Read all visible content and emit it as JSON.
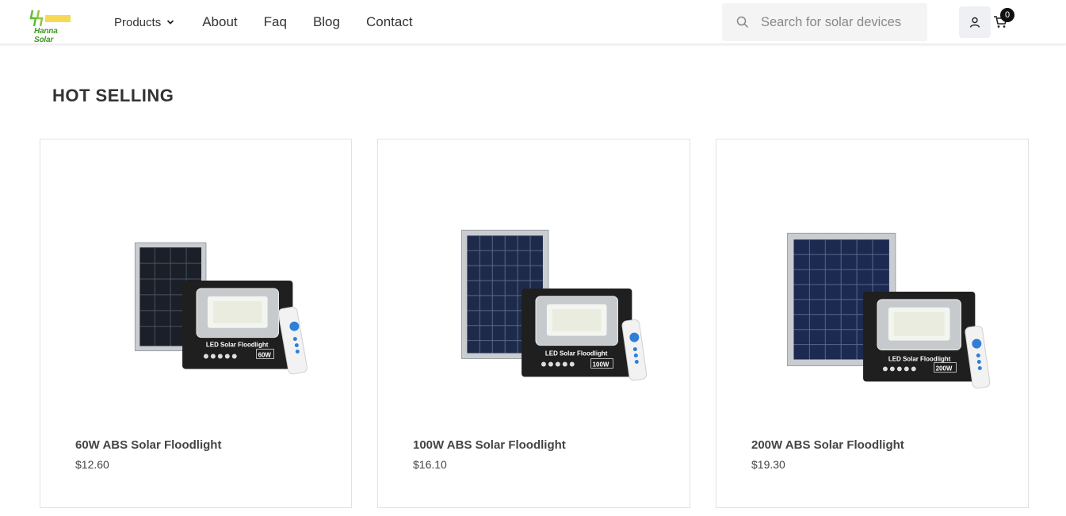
{
  "header": {
    "logo_text": "Hanna Solar",
    "nav": [
      {
        "label": "Products"
      },
      {
        "label": "About"
      },
      {
        "label": "Faq"
      },
      {
        "label": "Blog"
      },
      {
        "label": "Contact"
      }
    ],
    "search": {
      "placeholder": "Search for solar devices"
    },
    "cart_count": "0",
    "icons": [
      "search-icon",
      "user-icon",
      "cart-icon",
      "chevron-down-icon"
    ]
  },
  "section": {
    "title": "HOT SELLING"
  },
  "products": [
    {
      "name": "60W ABS Solar Floodlight",
      "price": "$12.60",
      "label": "LED Solar Floodlight",
      "watt": "60W"
    },
    {
      "name": "100W ABS Solar Floodlight",
      "price": "$16.10",
      "label": "LED Solar Floodlight",
      "watt": "100W"
    },
    {
      "name": "200W ABS Solar Floodlight",
      "price": "$19.30",
      "label": "LED Solar Floodlight",
      "watt": "200W"
    }
  ],
  "colors": {
    "logo_green": "#3a9a1f",
    "text": "#333333",
    "search_bg": "#f4f4f4",
    "badge": "#111111"
  }
}
